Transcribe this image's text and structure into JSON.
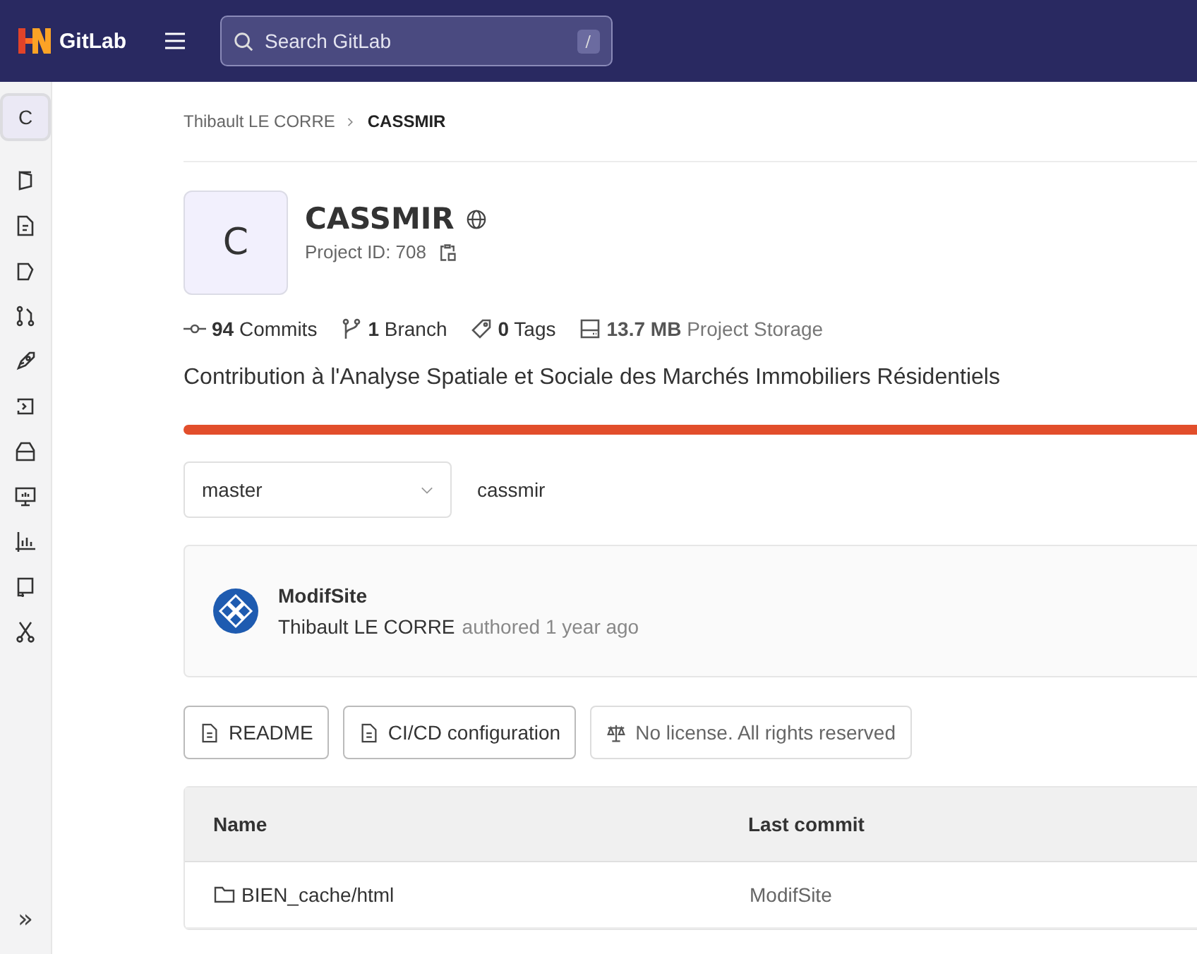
{
  "topbar": {
    "brand": "GitLab",
    "search": {
      "placeholder": "Search GitLab",
      "shortcut": "/"
    }
  },
  "sidebar": {
    "project_letter": "C",
    "items": [
      {
        "kind": "overview"
      },
      {
        "kind": "code"
      },
      {
        "kind": "issues"
      },
      {
        "kind": "merge"
      },
      {
        "kind": "deploy"
      },
      {
        "kind": "operate"
      },
      {
        "kind": "packages"
      },
      {
        "kind": "monitor"
      },
      {
        "kind": "analytics"
      },
      {
        "kind": "wiki"
      },
      {
        "kind": "snippets"
      }
    ],
    "expand": "»"
  },
  "breadcrumb": [
    {
      "label": "Thibault LE CORRE",
      "current": false
    },
    {
      "label": "CASSMIR",
      "current": true
    }
  ],
  "project": {
    "letter": "C",
    "name": "CASSMIR",
    "id_label": "Project ID: 708"
  },
  "stats": [
    {
      "kind": "commits",
      "count": "94",
      "label": "Commits"
    },
    {
      "kind": "branch",
      "count": "1",
      "label": "Branch"
    },
    {
      "kind": "tags",
      "count": "0",
      "label": "Tags"
    },
    {
      "kind": "storage",
      "count": "13.7 MB",
      "label": "Project Storage"
    }
  ],
  "description": "Contribution à l'Analyse Spatiale et Sociale des Marchés Immobiliers Résidentiels",
  "branch": {
    "value": "master",
    "path": "cassmir"
  },
  "commit": {
    "title": "ModifSite",
    "author": "Thibault LE CORRE",
    "meta": "authored 1 year ago"
  },
  "buttons": [
    {
      "kind": "readme",
      "label": "README"
    },
    {
      "kind": "cicd",
      "label": "CI/CD configuration"
    },
    {
      "kind": "license",
      "label": "No license. All rights reserved"
    }
  ],
  "table": {
    "columns": [
      "Name",
      "Last commit"
    ],
    "rows": [
      {
        "kind": "folder",
        "name": "BIEN_cache/html",
        "last_commit": "ModifSite"
      }
    ]
  }
}
